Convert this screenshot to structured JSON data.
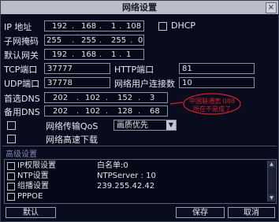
{
  "window": {
    "title": "网络设置",
    "close_glyph": "×"
  },
  "fields": {
    "ip_label": "IP 地址",
    "ip": [
      "192",
      "168",
      "1",
      "108"
    ],
    "dhcp_label": "DHCP",
    "mask_label": "子网掩码",
    "mask": [
      "255",
      "255",
      "255",
      "0"
    ],
    "gateway_label": "默认网关",
    "gateway": [
      "192",
      "168",
      "1",
      "1"
    ],
    "tcp_label": "TCP端口",
    "tcp": "37777",
    "http_label": "HTTP端口",
    "http": "81",
    "udp_label": "UDP端口",
    "udp": "37778",
    "maxconn_label": "网络用户连接数",
    "maxconn": "10",
    "dns1_label": "首选DNS",
    "dns1": [
      "202",
      "102",
      "152",
      "3"
    ],
    "dns2_label": "备用DNS",
    "dns2": [
      "202",
      "102",
      "128",
      "68"
    ],
    "qos_label": "网络传输QoS",
    "qos_value": "画质优先",
    "download_label": "网络高速下载"
  },
  "annotation": {
    "line1": "中国联通宽 088",
    "line2": "所在不是成了"
  },
  "advanced": {
    "title": "高级设置",
    "rows": [
      {
        "name": "IP权限设置",
        "value": "白名单:0"
      },
      {
        "name": "NTP设置",
        "value": "NTPServer : 10"
      },
      {
        "name": "组播设置",
        "value": "239.255.42.42"
      },
      {
        "name": "PPPOE",
        "value": ""
      }
    ]
  },
  "buttons": {
    "default": "默认",
    "save": "保存",
    "cancel": "取消"
  },
  "colors": {
    "title_bg": "#b9bdc9",
    "bg": "#080c1c",
    "accent_red": "#d8202a"
  }
}
